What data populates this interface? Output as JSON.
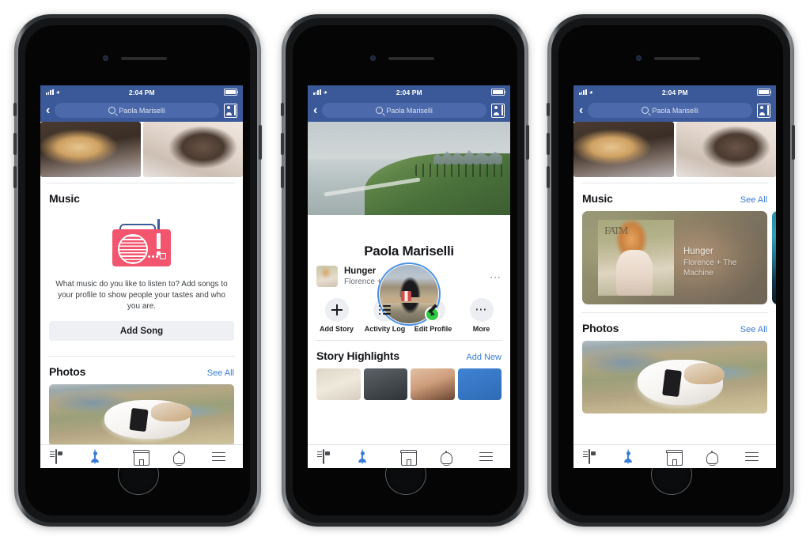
{
  "meta": {
    "scene": "three-iphone-mockups-facebook-profile",
    "background_color": "#ffffff"
  },
  "status_bar": {
    "time": "2:04 PM",
    "signal_icon": "cellular-signal-icon",
    "wifi_icon": "wifi-icon",
    "battery_icon": "battery-icon"
  },
  "nav_bar": {
    "back_icon": "back-chevron-icon",
    "search_icon": "search-icon",
    "search_value": "Paola Mariselli",
    "search_placeholder": "Search",
    "contacts_icon": "contacts-icon",
    "background_color": "#3b5998"
  },
  "tab_bar": {
    "items": [
      {
        "name": "news-feed",
        "icon": "news-feed-icon",
        "active": false
      },
      {
        "name": "profile",
        "icon": "profile-icon",
        "active": true
      },
      {
        "name": "marketplace",
        "icon": "marketplace-icon",
        "active": false
      },
      {
        "name": "notifications",
        "icon": "bell-icon",
        "active": false
      },
      {
        "name": "menu",
        "icon": "hamburger-menu-icon",
        "active": false
      }
    ],
    "active_color": "#3a7bd5",
    "inactive_color": "#4a4d52"
  },
  "colors": {
    "facebook_blue": "#3b5998",
    "link_blue": "#3a7bd5",
    "online_green": "#2ecc40",
    "radio_red": "#f2556d",
    "button_gray": "#eff0f3"
  },
  "phone1": {
    "photos_strip": [
      {
        "alt": "sleeping-cream-terrier-on-couch"
      },
      {
        "alt": "brindle-schnauzer-on-white-blanket"
      }
    ],
    "music": {
      "title": "Music",
      "illustration_icon": "radio-icon",
      "empty_text": "What music do you like to listen to? Add songs to your profile to show people your tastes and who you are.",
      "button_label": "Add Song"
    },
    "photos": {
      "title": "Photos",
      "see_all": "See All",
      "featured_alt": "jack-russell-terrier-on-hilltop-overlooking-bay"
    }
  },
  "phone2": {
    "cover_alt": "coastal-cliffside-city-with-palm-trees-and-ocean",
    "avatar_alt": "woman-in-black-dress-on-terrace-overlooking-city",
    "online_badge": true,
    "profile_name": "Paola Mariselli",
    "song": {
      "title": "Hunger",
      "artist": "Florence + The Machine",
      "menu_icon": "more-options-icon",
      "thumb_alt": "florence-and-the-machine-high-as-hope-album-art"
    },
    "actions": [
      {
        "label": "Add Story",
        "icon": "plus-icon"
      },
      {
        "label": "Activity Log",
        "icon": "list-icon"
      },
      {
        "label": "Edit Profile",
        "icon": "pencil-icon"
      },
      {
        "label": "More",
        "icon": "more-dots-icon"
      }
    ],
    "story_highlights": {
      "title": "Story Highlights",
      "add_new": "Add New",
      "thumbs": [
        "beige-fabric",
        "dark-gray-surface",
        "tan-skin-tone",
        "blue-gradient"
      ]
    }
  },
  "phone3": {
    "photos_strip": [
      {
        "alt": "sleeping-cream-terrier-on-couch"
      },
      {
        "alt": "brindle-schnauzer-on-white-blanket"
      }
    ],
    "music": {
      "title": "Music",
      "see_all": "See All",
      "cards": [
        {
          "song_title": "Hunger",
          "artist": "Florence + The\nMachine",
          "artist_line1": "Florence + The",
          "artist_line2": "Machine",
          "album_logo": "FATM",
          "art_alt": "florence-and-the-machine-high-as-hope-album-art"
        },
        {
          "art_alt": "teal-blue-album-art-partially-visible"
        }
      ]
    },
    "photos": {
      "title": "Photos",
      "see_all": "See All",
      "featured_alt": "jack-russell-terrier-on-hilltop-overlooking-bay"
    }
  }
}
